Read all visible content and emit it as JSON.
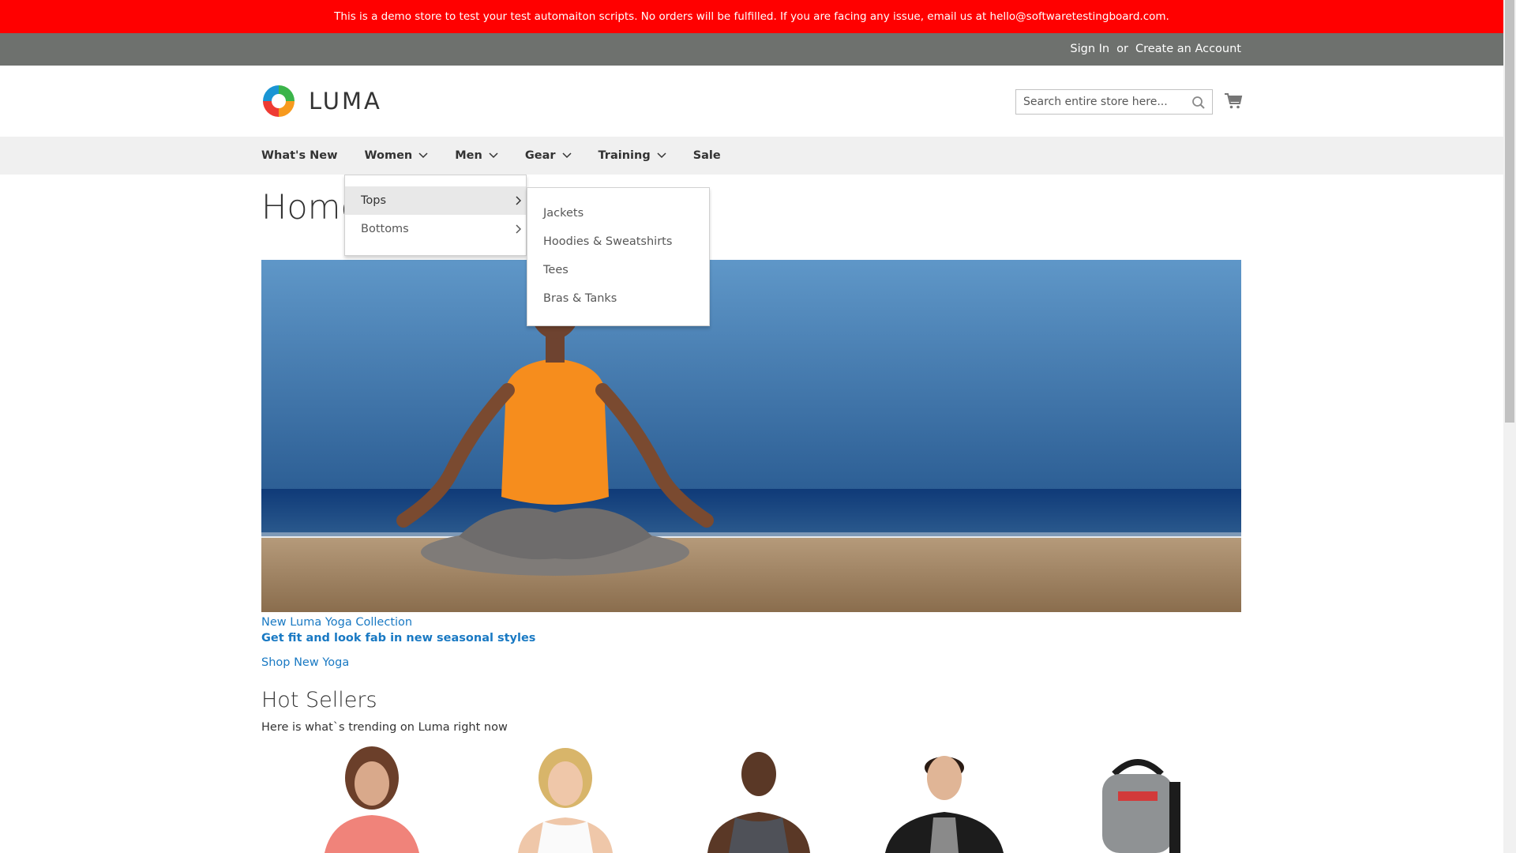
{
  "demo_banner": "This is a demo store to test your test automaiton scripts. No orders will be fulfilled. If you are facing any issue, email us at hello@softwaretestingboard.com.",
  "top_links": {
    "sign_in": "Sign In",
    "or": "or",
    "create_account": "Create an Account"
  },
  "logo": {
    "text": "LUMA",
    "icon": "luma-logo-icon"
  },
  "search": {
    "placeholder": "Search entire store here...",
    "icon": "search-icon"
  },
  "cart": {
    "icon": "cart-icon"
  },
  "nav": {
    "items": [
      {
        "label": "What's New",
        "has_dropdown": false
      },
      {
        "label": "Women",
        "has_dropdown": true
      },
      {
        "label": "Men",
        "has_dropdown": true
      },
      {
        "label": "Gear",
        "has_dropdown": true
      },
      {
        "label": "Training",
        "has_dropdown": true
      },
      {
        "label": "Sale",
        "has_dropdown": false
      }
    ]
  },
  "women_menu": {
    "items": [
      {
        "label": "Tops",
        "active": true
      },
      {
        "label": "Bottoms",
        "active": false
      }
    ],
    "tops_submenu": [
      "Jackets",
      "Hoodies & Sweatshirts",
      "Tees",
      "Bras & Tanks"
    ]
  },
  "page_title": "Home",
  "hero": {
    "caption": "New Luma Yoga Collection",
    "tagline": "Get fit and look fab in new seasonal styles",
    "link": "Shop New Yoga"
  },
  "hot_sellers": {
    "title": "Hot Sellers",
    "subtitle": "Here is what`s trending on Luma right now"
  },
  "colors": {
    "banner": "#ff0000",
    "top_panel": "#6e716e",
    "nav_bg": "#f0f0f0",
    "link": "#1979c3"
  }
}
